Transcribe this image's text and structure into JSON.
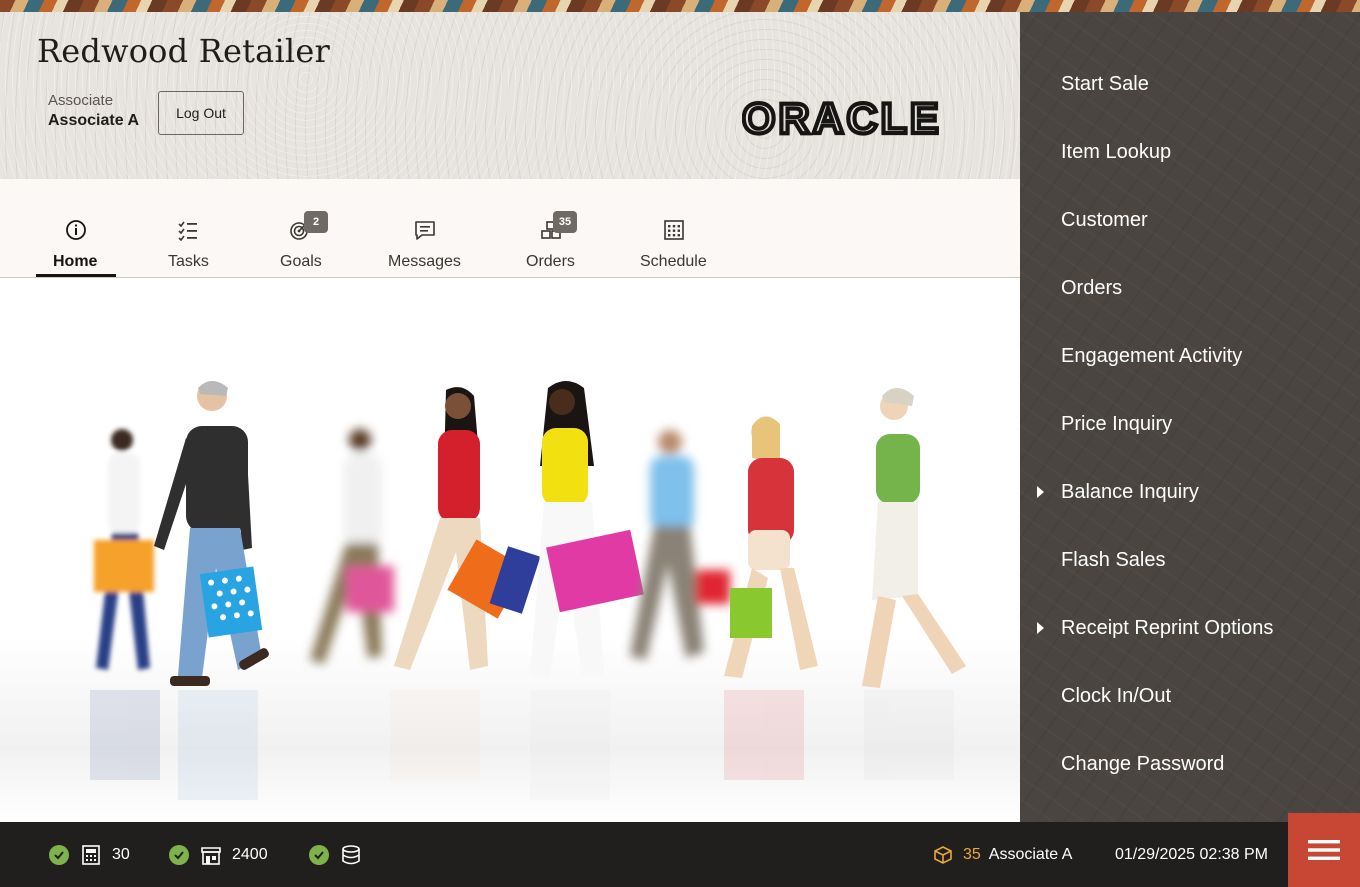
{
  "header": {
    "store_name": "Redwood Retailer",
    "associate_role": "Associate",
    "associate_name": "Associate A",
    "logout_label": "Log Out",
    "brand_logo": "ORACLE"
  },
  "tabs": [
    {
      "label": "Home",
      "icon": "info-circle-icon",
      "active": true
    },
    {
      "label": "Tasks",
      "icon": "checklist-icon"
    },
    {
      "label": "Goals",
      "icon": "target-icon",
      "badge": "2"
    },
    {
      "label": "Messages",
      "icon": "chat-icon"
    },
    {
      "label": "Orders",
      "icon": "boxes-icon",
      "badge": "35"
    },
    {
      "label": "Schedule",
      "icon": "calendar-icon"
    }
  ],
  "menu": {
    "items": [
      {
        "label": "Start Sale"
      },
      {
        "label": "Item Lookup"
      },
      {
        "label": "Customer"
      },
      {
        "label": "Orders"
      },
      {
        "label": "Engagement Activity"
      },
      {
        "label": "Price Inquiry"
      },
      {
        "label": "Balance Inquiry",
        "has_submenu": true
      },
      {
        "label": "Flash Sales"
      },
      {
        "label": "Receipt Reprint Options",
        "has_submenu": true
      },
      {
        "label": "Clock In/Out"
      },
      {
        "label": "Change Password"
      }
    ]
  },
  "status_bar": {
    "register_count": "30",
    "store_number": "2400",
    "orders_count": "35",
    "associate": "Associate A",
    "datetime": "01/29/2025 02:38 PM"
  },
  "colors": {
    "accent": "#c74634",
    "side_menu_bg": "#4a4540",
    "status_ok": "#7fb24a",
    "badge_bg": "#6f6a64"
  }
}
